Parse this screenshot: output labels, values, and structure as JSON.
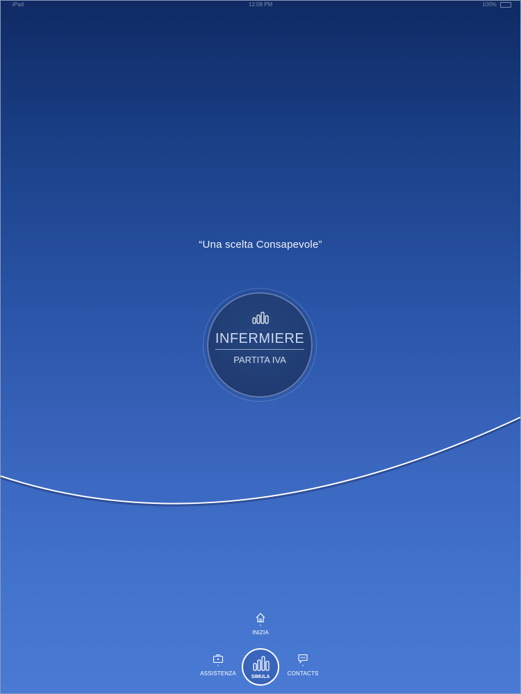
{
  "status_bar": {
    "left": "iPad",
    "time": "12:08 PM",
    "battery": "100%"
  },
  "hero": {
    "tagline": "“Una scelta Consapevole”"
  },
  "profile": {
    "title": "INFERMIERE",
    "subtitle": "PARTITA IVA",
    "icon": "bar-chart-icon"
  },
  "bottom_nav": {
    "inizia": {
      "label": "INIZIA",
      "icon": "home-icon"
    },
    "assistenza": {
      "label": "ASSISTENZA",
      "icon": "briefcase-icon"
    },
    "simula": {
      "label": "SIMULA",
      "icon": "bar-chart-icon",
      "selected": true
    },
    "contacts": {
      "label": "CONTACTS",
      "icon": "chat-bubble-icon"
    }
  },
  "colors": {
    "background_top": "#0f2a63",
    "background_bottom": "#4a7ad4",
    "disc": "#203c72",
    "arc": "#ffffff"
  }
}
